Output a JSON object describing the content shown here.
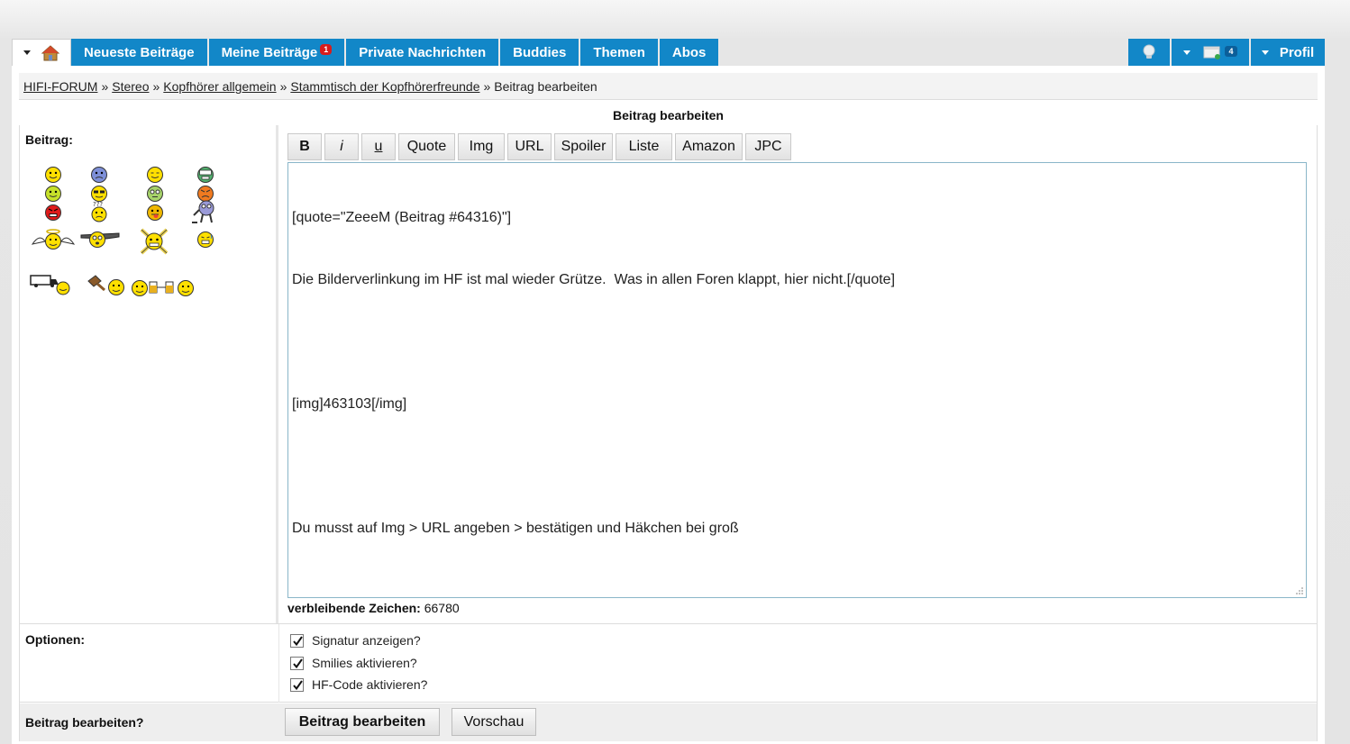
{
  "nav": {
    "tabs": [
      {
        "label": "Neueste Beiträge"
      },
      {
        "label": "Meine Beiträge",
        "badge": "1"
      },
      {
        "label": "Private Nachrichten"
      },
      {
        "label": "Buddies"
      },
      {
        "label": "Themen"
      },
      {
        "label": "Abos"
      }
    ],
    "messages_badge": "4",
    "profile_label": "Profil"
  },
  "breadcrumb": {
    "items": [
      "HIFI-FORUM",
      "Stereo",
      "Kopfhörer allgemein",
      "Stammtisch der Kopfhörerfreunde"
    ],
    "separator": "»",
    "current": "Beitrag bearbeiten"
  },
  "form": {
    "title": "Beitrag bearbeiten",
    "beitrag_label": "Beitrag:",
    "toolbar": [
      "B",
      "i",
      "u",
      "Quote",
      "Img",
      "URL",
      "Spoiler",
      "Liste",
      "Amazon",
      "JPC"
    ],
    "editor_lines": [
      "[quote=\"ZeeeM (Beitrag #64316)\"]",
      "Die Bilderverlinkung im HF ist mal wieder Grütze.  Was in allen Foren klappt, hier nicht.[/quote]",
      "",
      "[img]463103[/img]",
      "",
      "Du musst auf Img > URL angeben > bestätigen und Häkchen bei groß"
    ],
    "remaining_label": "verbleibende Zeichen:",
    "remaining_value": "66780",
    "options_label": "Optionen:",
    "options": [
      {
        "label": "Signatur anzeigen?",
        "checked": true
      },
      {
        "label": "Smilies aktivieren?",
        "checked": true
      },
      {
        "label": "HF-Code aktivieren?",
        "checked": true
      }
    ],
    "submit_label": "Beitrag bearbeiten?",
    "submit_button": "Beitrag bearbeiten",
    "preview_button": "Vorschau"
  },
  "smilies": [
    "smile",
    "sad",
    "grin",
    "teeth",
    "smile",
    "cool",
    "dizzy",
    "angry",
    "mad",
    "confused",
    "tongue",
    "robot",
    "angel",
    "eyes",
    "pirate",
    "nervous",
    "truck",
    "hammer",
    "cheers"
  ]
}
